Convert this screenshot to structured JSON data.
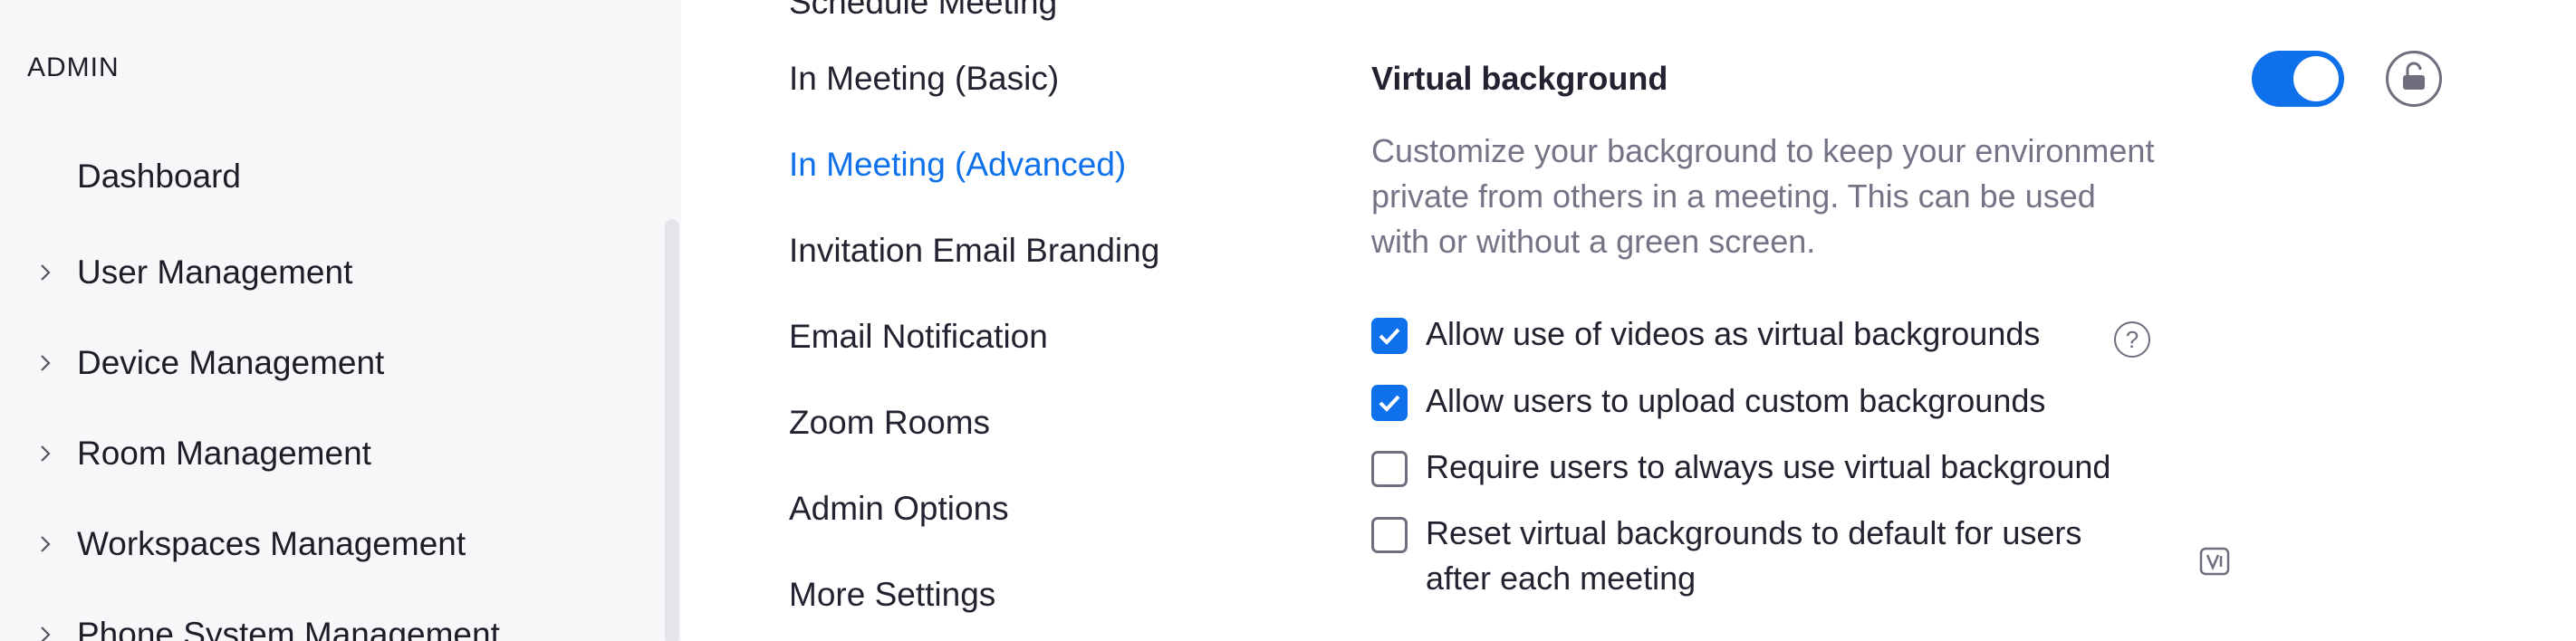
{
  "sidebar": {
    "heading": "ADMIN",
    "dashboard": "Dashboard",
    "items": [
      {
        "label": "User Management"
      },
      {
        "label": "Device Management"
      },
      {
        "label": "Room Management"
      },
      {
        "label": "Workspaces Management"
      },
      {
        "label": "Phone System Management"
      }
    ]
  },
  "settings_nav": {
    "items": [
      {
        "label": "Schedule Meeting"
      },
      {
        "label": "In Meeting (Basic)"
      },
      {
        "label": "In Meeting (Advanced)"
      },
      {
        "label": "Invitation Email Branding"
      },
      {
        "label": "Email Notification"
      },
      {
        "label": "Zoom Rooms"
      },
      {
        "label": "Admin Options"
      },
      {
        "label": "More Settings"
      }
    ],
    "active": "In Meeting (Advanced)"
  },
  "main": {
    "title": "Virtual background",
    "description_lines": [
      "Customize your background to keep your environment",
      "private from others in a meeting. This can be used",
      "with or without a green screen."
    ],
    "enabled": true,
    "options": [
      {
        "label": "Allow use of videos as virtual backgrounds",
        "checked": true
      },
      {
        "label": "Allow users to upload custom backgrounds",
        "checked": true
      },
      {
        "label": "Require users to always use virtual background",
        "checked": false
      },
      {
        "label_lines": [
          "Reset virtual backgrounds to default for users",
          "after each meeting"
        ],
        "checked": false
      }
    ],
    "help_glyph": "?"
  },
  "icons": {
    "chevron": "chevron-right-icon",
    "lock": "unlock-icon",
    "help": "help-icon",
    "version": "version-icon"
  },
  "colors": {
    "accent": "#0e71eb",
    "sidebar_bg": "#f7f7fa",
    "muted_text": "#747487"
  }
}
